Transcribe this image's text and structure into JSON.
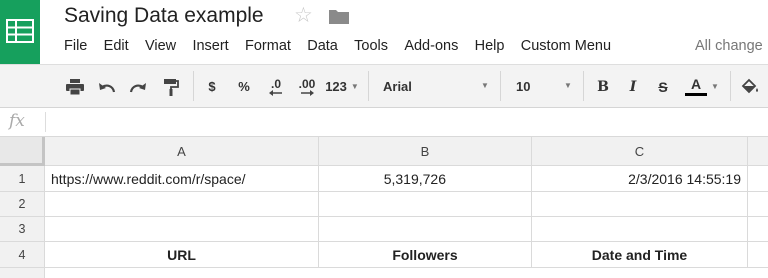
{
  "header": {
    "title": "Saving Data example",
    "save_status": "All change",
    "menu": [
      "File",
      "Edit",
      "View",
      "Insert",
      "Format",
      "Data",
      "Tools",
      "Add-ons",
      "Help",
      "Custom Menu"
    ]
  },
  "toolbar": {
    "currency": "$",
    "percent": "%",
    "decrease_decimals": ".0",
    "increase_decimals": ".00",
    "more_formats": "123",
    "font": "Arial",
    "font_size": "10",
    "bold": "B",
    "italic": "I",
    "strikethrough": "S",
    "text_color": "A"
  },
  "formula_bar": {
    "fx": "fx"
  },
  "grid": {
    "columns": [
      "A",
      "B",
      "C"
    ],
    "rows": [
      "1",
      "2",
      "3",
      "4"
    ],
    "cells": {
      "A1": "https://www.reddit.com/r/space/",
      "B1": "5,319,726",
      "C1": "2/3/2016 14:55:19",
      "A4": "URL",
      "B4": "Followers",
      "C4": "Date and Time"
    }
  },
  "colors": {
    "brand": "#16a05d",
    "text_color_bar": "#000000"
  }
}
